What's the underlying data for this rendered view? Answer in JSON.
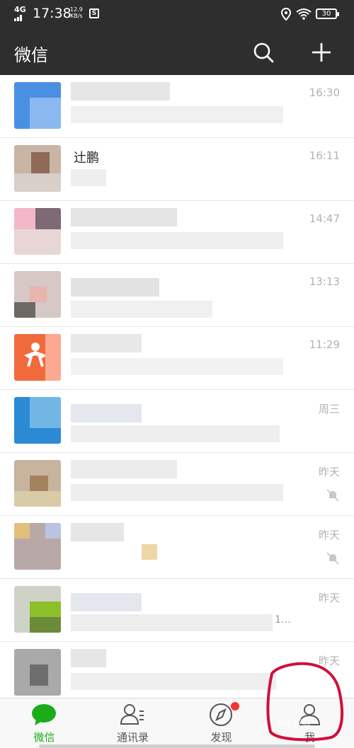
{
  "status_bar": {
    "network": "4G",
    "time": "17:38",
    "speed_value": "12.9",
    "speed_unit": "KB/s",
    "s_badge": "S",
    "battery": "30"
  },
  "title_bar": {
    "title": "微信",
    "search_icon": "search-icon",
    "add_icon": "plus-icon"
  },
  "chats": [
    {
      "name": "",
      "time": "16:30",
      "muted": false
    },
    {
      "name": "辻鹏",
      "time": "16:11",
      "muted": false
    },
    {
      "name": "",
      "time": "14:47",
      "muted": false
    },
    {
      "name": "",
      "time": "13:13",
      "muted": false
    },
    {
      "name": "",
      "time": "11:29",
      "muted": false
    },
    {
      "name": "",
      "time": "周三",
      "muted": false
    },
    {
      "name": "",
      "time": "昨天",
      "muted": true
    },
    {
      "name": "",
      "time": "昨天",
      "muted": true
    },
    {
      "name": "",
      "time": "昨天",
      "muted": false,
      "preview_tail": "1…"
    },
    {
      "name": "",
      "time": "昨天",
      "muted": false
    }
  ],
  "bottom_nav": {
    "items": [
      {
        "label": "微信",
        "icon": "chat-bubble-icon",
        "active": true
      },
      {
        "label": "通讯录",
        "icon": "contacts-icon",
        "active": false
      },
      {
        "label": "发现",
        "icon": "compass-icon",
        "active": false,
        "badge": true
      },
      {
        "label": "我",
        "icon": "person-icon",
        "active": false
      }
    ]
  },
  "colors": {
    "header_bg": "#2e2e2e",
    "active_green": "#1aad19",
    "badge_red": "#f43530",
    "annotation_red": "#d0103a"
  },
  "watermark": "Bai 经验"
}
